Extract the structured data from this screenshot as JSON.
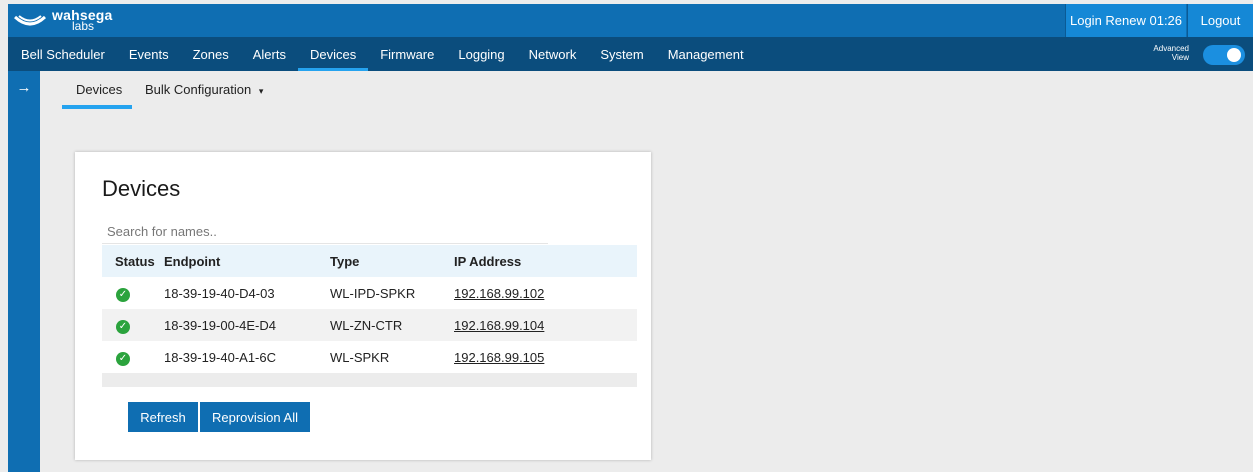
{
  "brand": {
    "line1": "wahsega",
    "line2": "labs"
  },
  "header": {
    "login_renew": "Login Renew 01:26",
    "logout": "Logout"
  },
  "nav": {
    "items": [
      {
        "label": "Bell Scheduler",
        "active": false
      },
      {
        "label": "Events",
        "active": false
      },
      {
        "label": "Zones",
        "active": false
      },
      {
        "label": "Alerts",
        "active": false
      },
      {
        "label": "Devices",
        "active": true
      },
      {
        "label": "Firmware",
        "active": false
      },
      {
        "label": "Logging",
        "active": false
      },
      {
        "label": "Network",
        "active": false
      },
      {
        "label": "System",
        "active": false
      },
      {
        "label": "Management",
        "active": false
      }
    ],
    "advanced_view": {
      "line1": "Advanced",
      "line2": "View",
      "on": true
    }
  },
  "sidebar": {
    "icon": "arrow-right-icon"
  },
  "subtabs": {
    "devices": "Devices",
    "bulk": "Bulk Configuration",
    "bulk_caret": "▾"
  },
  "card": {
    "title": "Devices",
    "search_placeholder": "Search for names..",
    "columns": [
      "Status",
      "Endpoint",
      "Type",
      "IP Address"
    ],
    "rows": [
      {
        "status": "online",
        "endpoint": "18-39-19-40-D4-03",
        "type": "WL-IPD-SPKR",
        "ip": "192.168.99.102"
      },
      {
        "status": "online",
        "endpoint": "18-39-19-00-4E-D4",
        "type": "WL-ZN-CTR",
        "ip": "192.168.99.104"
      },
      {
        "status": "online",
        "endpoint": "18-39-19-40-A1-6C",
        "type": "WL-SPKR",
        "ip": "192.168.99.105"
      }
    ],
    "buttons": {
      "refresh": "Refresh",
      "reprovision": "Reprovision All"
    }
  },
  "colors": {
    "topbar": "#0f6eb2",
    "navbar": "#0b4d7d",
    "accent": "#25a3ef",
    "status_ok": "#2ba33d"
  }
}
